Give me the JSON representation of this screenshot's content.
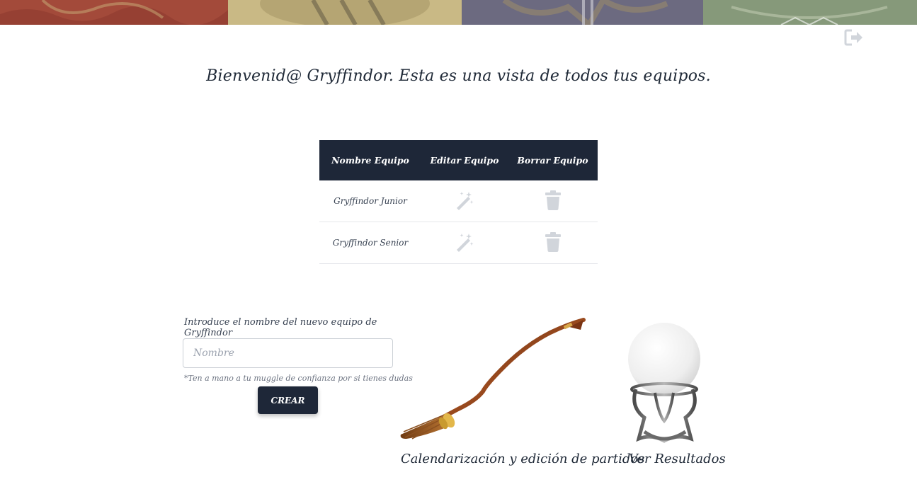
{
  "welcome": "Bienvenid@ Gryffindor. Esta es una vista de todos tus equipos.",
  "table": {
    "headers": [
      "Nombre Equipo",
      "Editar Equipo",
      "Borrar Equipo"
    ],
    "rows": [
      {
        "name": "Gryffindor Junior",
        "edit_icon": "magic-wand-icon",
        "delete_icon": "trash-icon"
      },
      {
        "name": "Gryffindor Senior",
        "edit_icon": "magic-wand-icon",
        "delete_icon": "trash-icon"
      }
    ]
  },
  "form": {
    "label": "Introduce el nombre del nuevo equipo de Gryffindor",
    "placeholder": "Nombre",
    "value": "",
    "hint": "*Ten a mano a tu muggle de confianza por si tienes dudas",
    "button": "CREAR"
  },
  "cards": {
    "schedule": "Calendarización y edición de partidos",
    "results": "Ver Resultados"
  },
  "icons": {
    "logout": "logout-icon",
    "edit": "magic-wand-icon",
    "delete": "trash-icon",
    "broom": "broomstick-image",
    "orb": "crystal-ball-image"
  },
  "colors": {
    "header_bg": "#1e2738",
    "icon_gray": "#d1d5db",
    "banner_gryffindor": "#a34a3a",
    "banner_hufflepuff": "#c9b985",
    "banner_ravenclaw": "#6c6a80",
    "banner_slytherin": "#86997a"
  }
}
